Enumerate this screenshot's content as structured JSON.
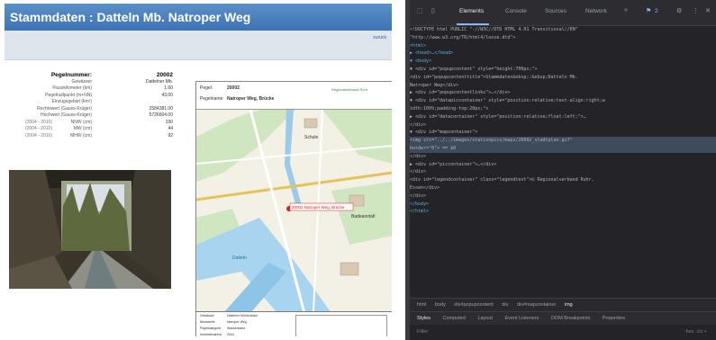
{
  "page": {
    "title": "Stammdaten : Datteln Mb. Natroper Weg",
    "back_link": "zurück"
  },
  "station": {
    "head_label": "Pegelnummer:",
    "head_value": "20002",
    "rows": [
      {
        "label": "Gewässer",
        "value": "Dattelner Mb."
      },
      {
        "label": "Flusskilometer (km)",
        "value": "1.60"
      },
      {
        "label": "Pegelnullpunkt (m+NN)",
        "value": "43.00"
      },
      {
        "label": "Einzugsgebiet (km²)",
        "value": ""
      },
      {
        "label": "Rechtswert (Gauss-Krüger)",
        "value": "2584381.00"
      },
      {
        "label": "Hochwert (Gauss-Krüger)",
        "value": "5726604.00"
      }
    ],
    "ranges": [
      {
        "period": "(2004 - 2010)",
        "label": "NNW (cm)",
        "value": "190"
      },
      {
        "period": "(2004 - 2010)",
        "label": "MW (cm)",
        "value": "44"
      },
      {
        "period": "(2004 - 2010)",
        "label": "MHW (cm)",
        "value": "92"
      }
    ]
  },
  "map": {
    "pegel_label": "Pegel:",
    "pegel_value": "20002",
    "name_label": "Pegelname:",
    "name_value": "Natroper Weg, Brücke",
    "org": "Regionalverband Ruhr",
    "marker_label": "20002 Natroper Weg, Brücke",
    "labels": {
      "datteln": "Datteln",
      "schule": "Schule",
      "badeanstalt": "Badeanstalt"
    },
    "legend": [
      {
        "k": "Gewässer",
        "v": "Dattelner Mühlenbach"
      },
      {
        "k": "Messstelle",
        "v": "Natroper Weg"
      },
      {
        "k": "Pegelkategorie",
        "v": "Wasserstand"
      },
      {
        "k": "Inbetriebnahme",
        "v": "2004"
      }
    ]
  },
  "devtools": {
    "tabs": [
      "Elements",
      "Console",
      "Sources",
      "Network"
    ],
    "active_tab": "Elements",
    "badge": "2",
    "code_lines": [
      "<!DOCTYPE html PUBLIC \"-//W3C//DTD HTML 4.01 Transitional//EN\"",
      "\"http://www.w3.org/TR/html4/loose.dtd\">",
      "<html>",
      "▶ <head>…</head>",
      "▼ <body>",
      "  ▼ <div id=\"popupcontent\" style=\"height:700px;\">",
      "      <div id=\"popupcontenttitle\">Stammdaten&nbsp;:&nbsp;Datteln Mb.",
      "      Natroper Weg</div>",
      "    ▶ <div id=\"popupcontentlinks\">…</div>",
      "    ▼ <div id=\"datapiccontainer\" style=\"position:relative;text-align:right;w",
      "      idth:100%;padding-top:20px;\">",
      "      ▶ <div id=\"datacontainer\" style=\"position:relative;float:left;\">…",
      "        </div>",
      "      ▼ <div id=\"mapcontainer\">",
      "          <img src=\"../../images/stationpics/maps/20002_stadtplan.gif\"",
      "          border=\"0\"> == $0",
      "        </div>",
      "      ▶ <div id=\"piccontainer\">…</div>",
      "      </div>",
      "      <div id=\"legendcontainer\" class=\"legendtext\">© Regionalverband Ruhr,",
      "      Essen</div>",
      "    </div>",
      "  </body>",
      "</html>"
    ],
    "breadcrumbs": [
      "html",
      "body",
      "div#popupcontent",
      "div",
      "div#mapcontainer",
      "img"
    ],
    "bottom_tabs": [
      "Styles",
      "Computed",
      "Layout",
      "Event Listeners",
      "DOM Breakpoints",
      "Properties"
    ],
    "filter_placeholder": "Filter",
    "filter_right": ":hov  .cls  +"
  }
}
